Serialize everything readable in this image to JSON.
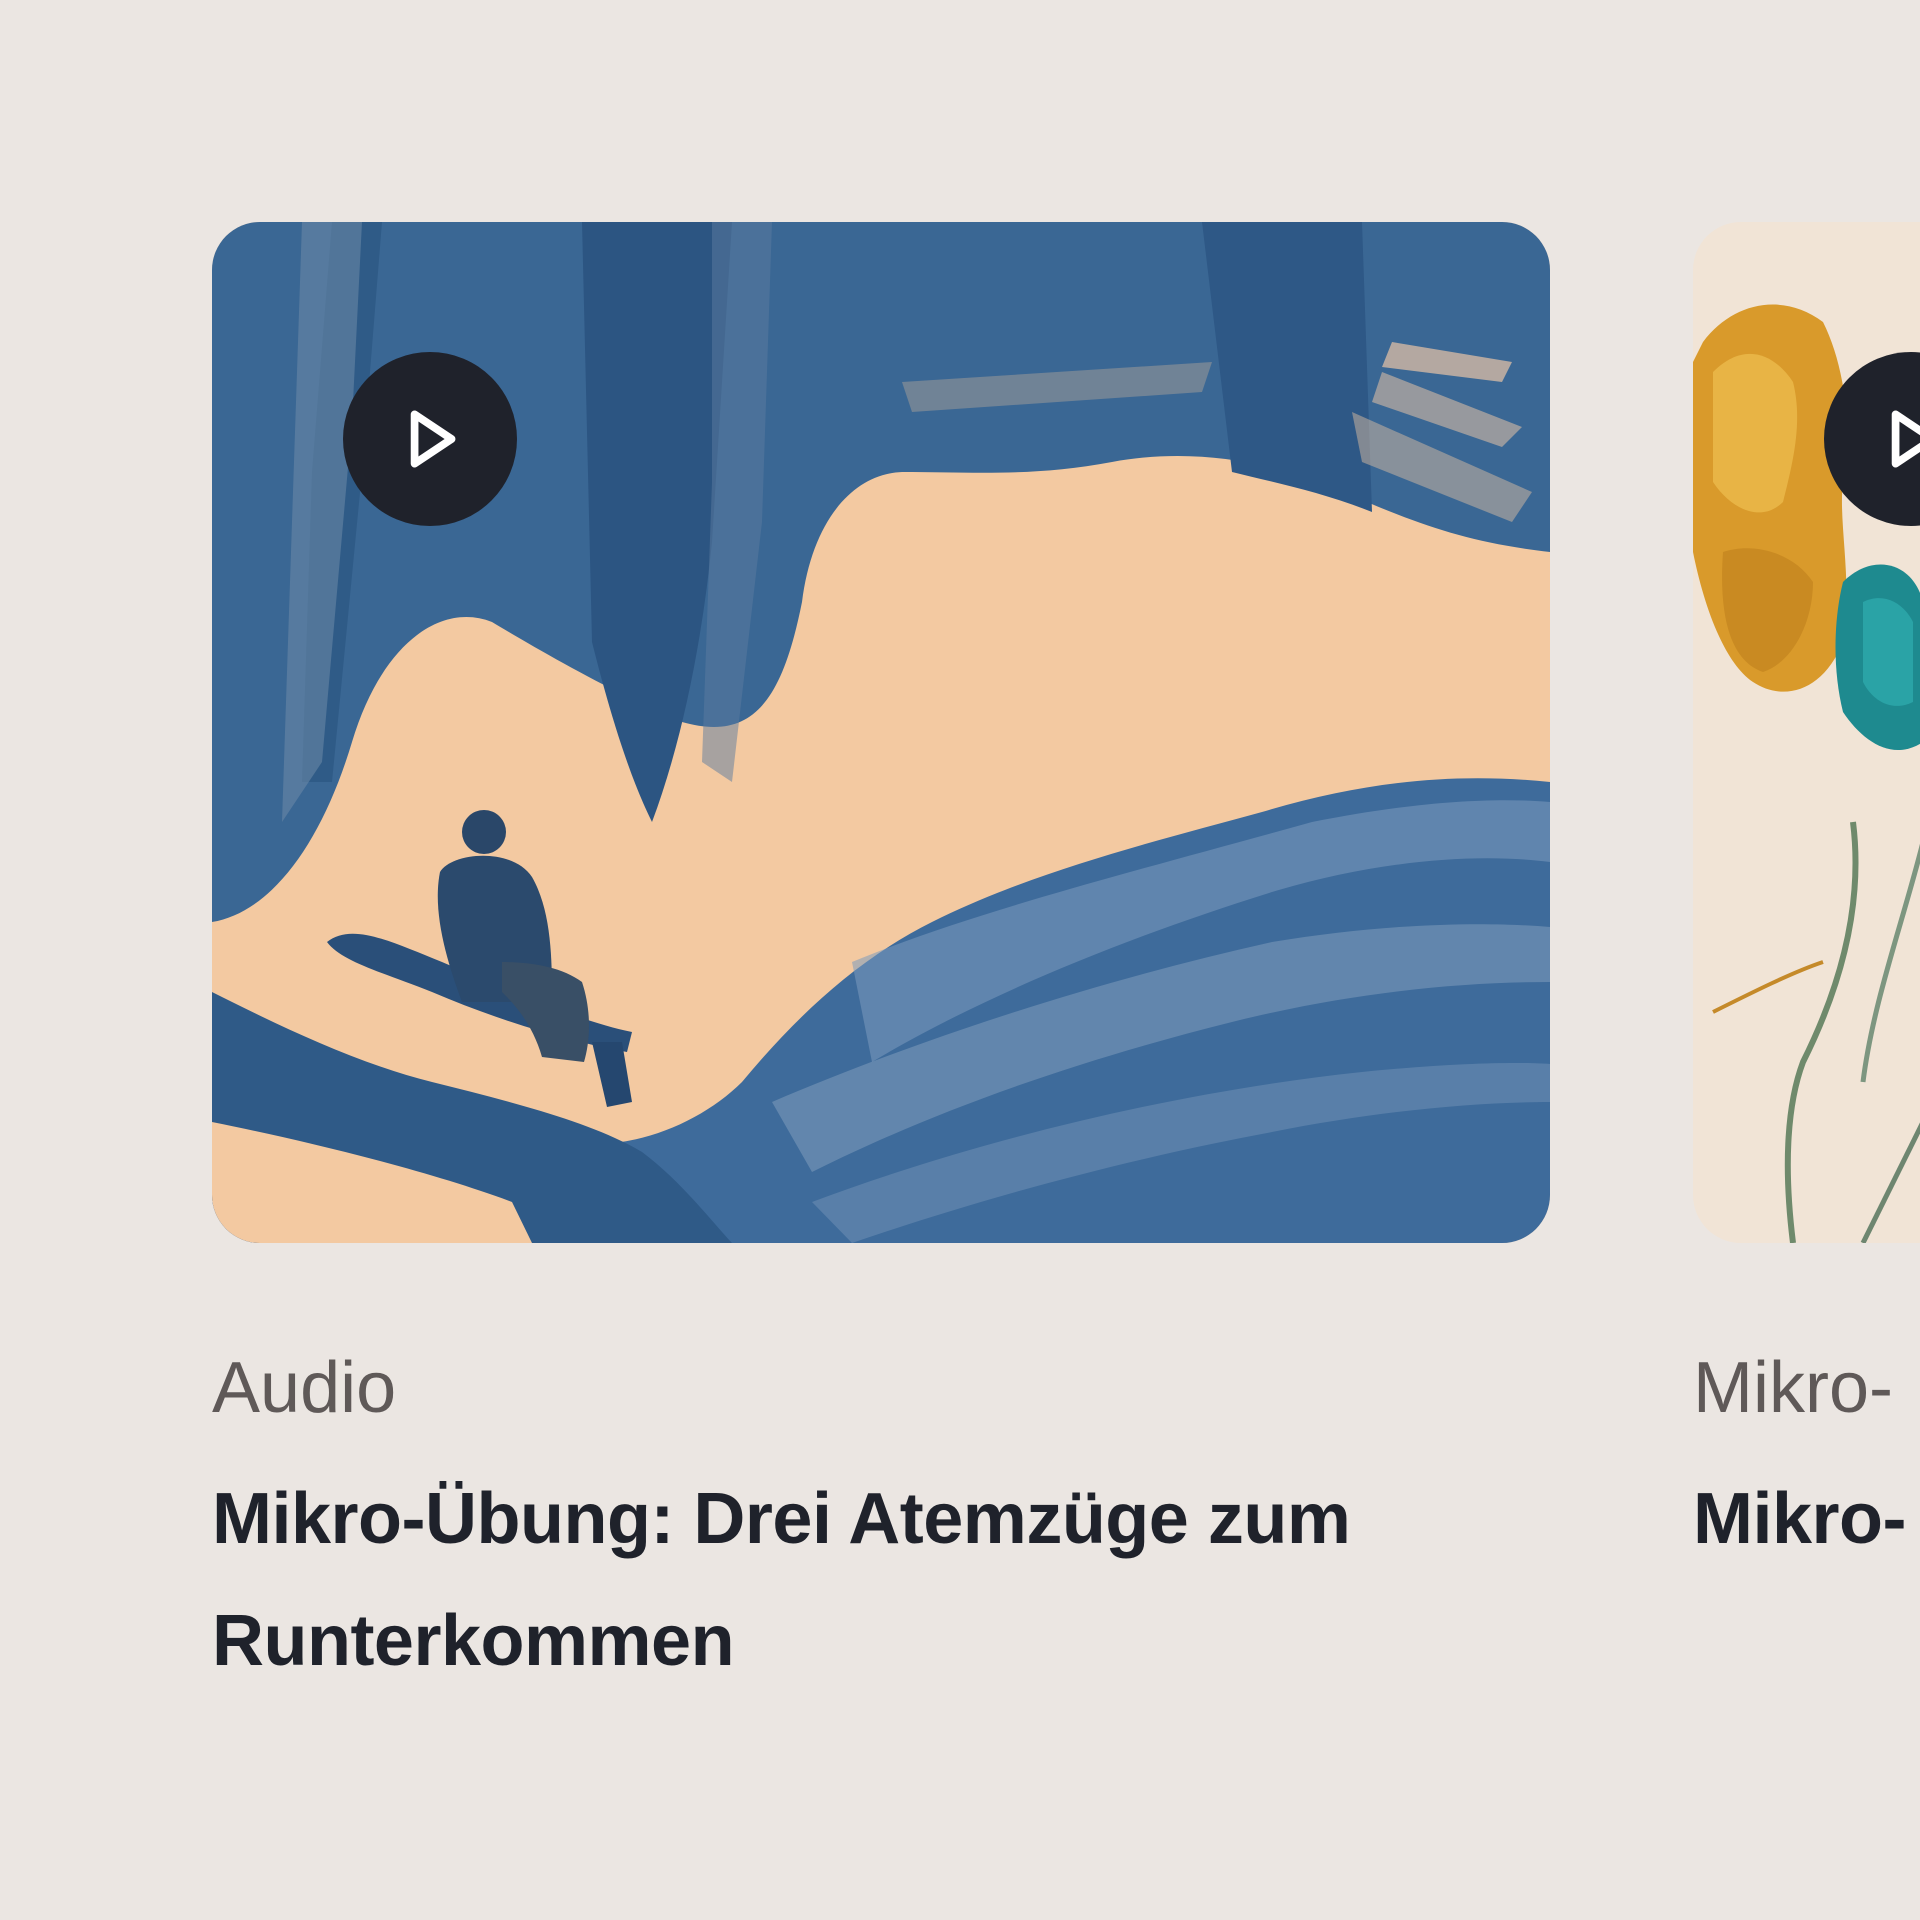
{
  "cards": [
    {
      "category": "Audio",
      "title": "Mikro-Übung: Drei Atemzüge zum Runterkommen",
      "play_icon": "play-icon",
      "image": "illustration-person-sitting-by-water"
    },
    {
      "category": "Mikro-",
      "title": "Mikro- loslass",
      "play_icon": "play-icon",
      "image": "illustration-dried-flowers"
    }
  ],
  "colors": {
    "background": "#ebe6e2",
    "title": "#1f222b",
    "category": "#5f5958",
    "play_button": "#1f222b",
    "art_blue": "#3f6c9b",
    "art_peach": "#f3c9a1"
  }
}
